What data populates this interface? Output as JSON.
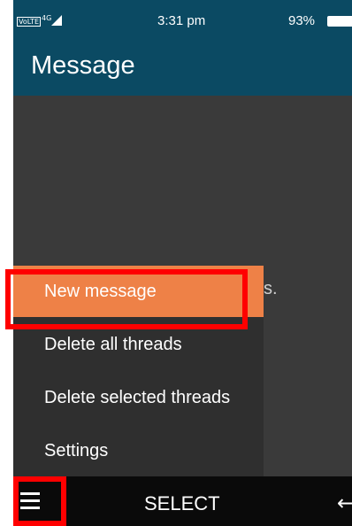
{
  "status_bar": {
    "volte": "VoLTE",
    "network": "4G",
    "time": "3:31 pm",
    "battery": "93%"
  },
  "header": {
    "title": "Message"
  },
  "content": {
    "background_text_fragment": "s."
  },
  "menu": {
    "items": [
      {
        "label": "New message",
        "selected": true
      },
      {
        "label": "Delete all threads",
        "selected": false
      },
      {
        "label": "Delete selected threads",
        "selected": false
      },
      {
        "label": "Settings",
        "selected": false
      }
    ]
  },
  "softkeys": {
    "left_icon": "menu-icon",
    "center_label": "SELECT",
    "right_icon": "back-arrow-icon"
  },
  "colors": {
    "header_bg": "#0b4a63",
    "selected_item_bg": "#ee8147",
    "content_bg": "#3a3a3a",
    "menu_bg": "#2f2f2f",
    "softkey_bg": "#0a0a0a",
    "highlight": "#ff0000"
  }
}
